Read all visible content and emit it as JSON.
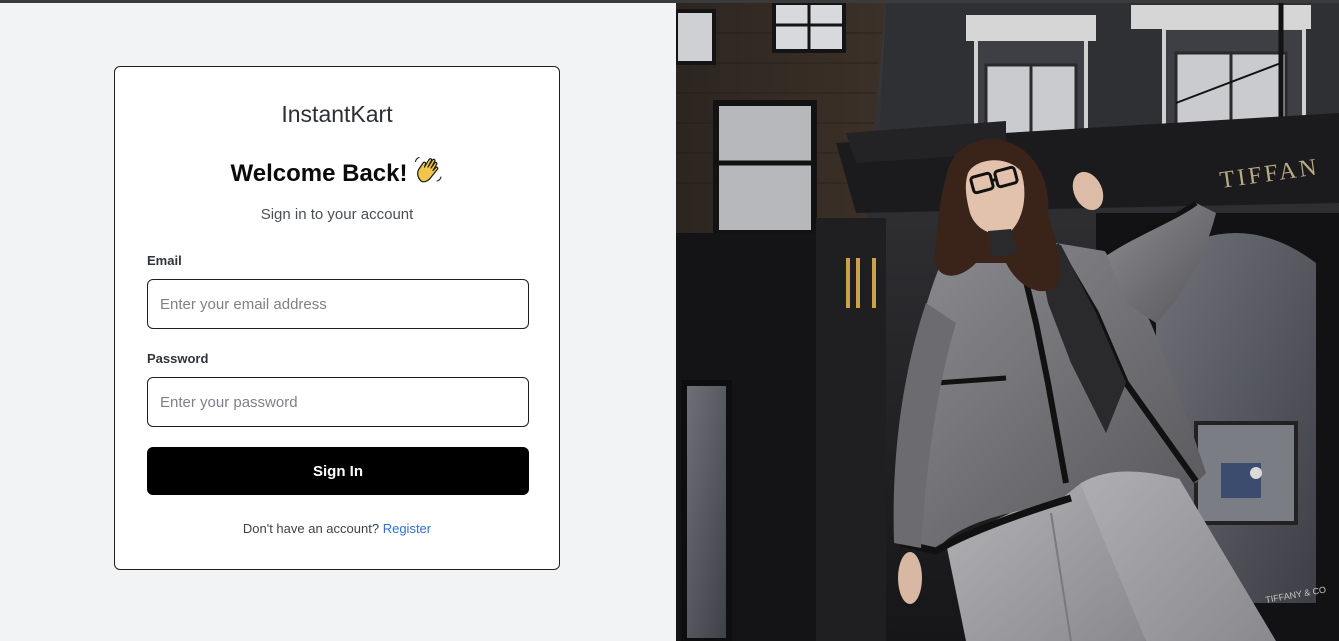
{
  "brand": {
    "name": "InstantKart"
  },
  "login": {
    "heading": "Welcome Back!",
    "heading_emoji": "👋",
    "subtitle": "Sign in to your account",
    "email": {
      "label": "Email",
      "placeholder": "Enter your email address",
      "value": ""
    },
    "password": {
      "label": "Password",
      "placeholder": "Enter your password",
      "value": ""
    },
    "submit_label": "Sign In",
    "footer_text": "Don't have an account?",
    "register_label": "Register"
  },
  "hero": {
    "sign_text": "TIFFAN",
    "plaque_text": "TIFFANY & CO"
  },
  "colors": {
    "primary_button": "#000000",
    "link": "#2f6fd6",
    "page_bg": "#f2f3f5"
  }
}
